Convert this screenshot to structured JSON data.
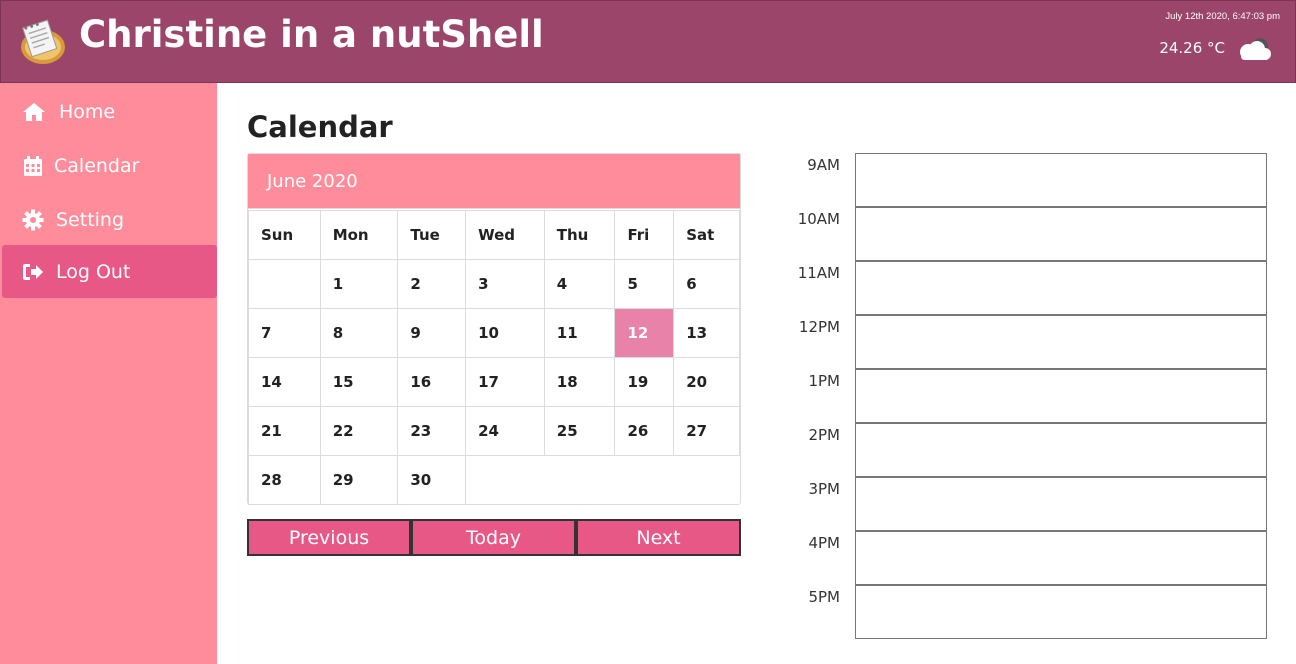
{
  "header": {
    "title": "Christine in a nutShell",
    "datetime": "July 12th 2020, 6:47:03 pm",
    "temperature": "24.26 °C",
    "weather_icon": "cloud-icon",
    "bg_color": "#9c456b"
  },
  "sidebar": {
    "bg_color": "#ff8c9a",
    "active_color": "#e85886",
    "items": [
      {
        "label": "Home",
        "icon": "home-icon"
      },
      {
        "label": "Calendar",
        "icon": "calendar-icon"
      },
      {
        "label": "Setting",
        "icon": "gear-icon"
      },
      {
        "label": "Log Out",
        "icon": "logout-icon",
        "active": true
      }
    ]
  },
  "main": {
    "title": "Calendar"
  },
  "calendar": {
    "month_label": "June 2020",
    "weekdays": [
      "Sun",
      "Mon",
      "Tue",
      "Wed",
      "Thu",
      "Fri",
      "Sat"
    ],
    "weeks": [
      [
        "",
        "1",
        "2",
        "3",
        "4",
        "5",
        "6"
      ],
      [
        "7",
        "8",
        "9",
        "10",
        "11",
        "12",
        "13"
      ],
      [
        "14",
        "15",
        "16",
        "17",
        "18",
        "19",
        "20"
      ],
      [
        "21",
        "22",
        "23",
        "24",
        "25",
        "26",
        "27"
      ],
      [
        "28",
        "29",
        "30",
        "",
        "",
        "",
        ""
      ]
    ],
    "highlighted_day": "12",
    "highlight_color": "#e882a8",
    "buttons": {
      "previous": "Previous",
      "today": "Today",
      "next": "Next"
    }
  },
  "schedule": {
    "slots": [
      {
        "label": "9AM",
        "value": ""
      },
      {
        "label": "10AM",
        "value": ""
      },
      {
        "label": "11AM",
        "value": ""
      },
      {
        "label": "12PM",
        "value": ""
      },
      {
        "label": "1PM",
        "value": ""
      },
      {
        "label": "2PM",
        "value": ""
      },
      {
        "label": "3PM",
        "value": ""
      },
      {
        "label": "4PM",
        "value": ""
      },
      {
        "label": "5PM",
        "value": ""
      }
    ]
  }
}
